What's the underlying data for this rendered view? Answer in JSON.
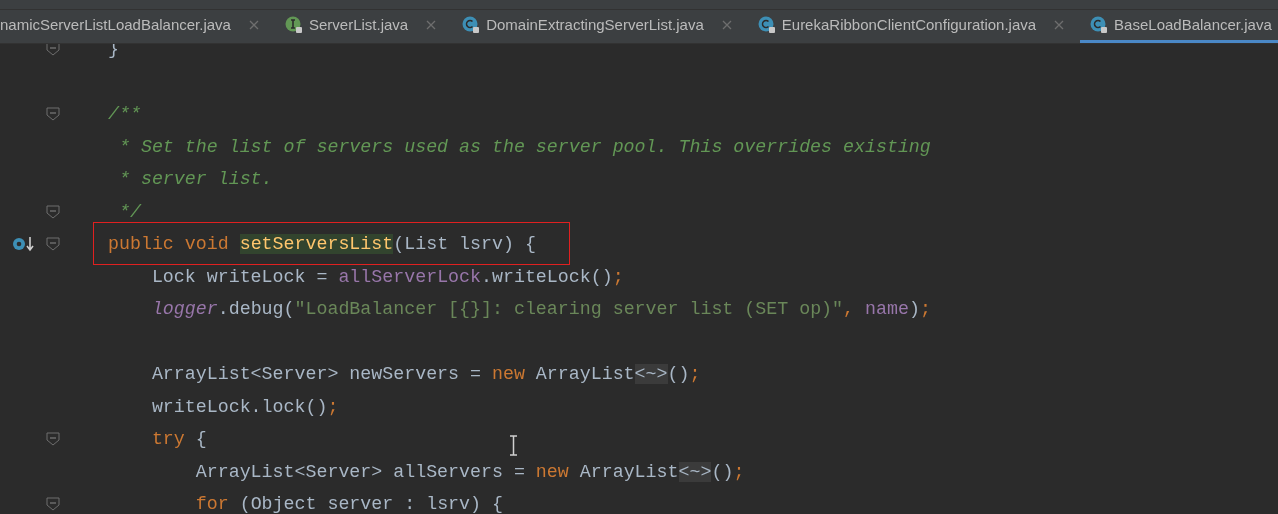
{
  "tabs": [
    {
      "label": "namicServerListLoadBalancer.java",
      "kind": "plain",
      "selected": false,
      "closable": true
    },
    {
      "label": "ServerList.java",
      "kind": "interface",
      "selected": false,
      "closable": true
    },
    {
      "label": "DomainExtractingServerList.java",
      "kind": "class",
      "selected": false,
      "closable": true
    },
    {
      "label": "EurekaRibbonClientConfiguration.java",
      "kind": "class",
      "selected": false,
      "closable": true
    },
    {
      "label": "BaseLoadBalancer.java",
      "kind": "class",
      "selected": true,
      "closable": false
    }
  ],
  "code": {
    "lines": [
      {
        "kind": "code",
        "fold": true,
        "gutter_icon": false,
        "tokens": [
          {
            "kind": "text",
            "text": "}"
          }
        ]
      },
      {
        "kind": "blank"
      },
      {
        "kind": "code",
        "fold": true,
        "gutter_icon": false,
        "tokens": [
          {
            "kind": "comment",
            "text": "/**"
          }
        ]
      },
      {
        "kind": "code",
        "fold": false,
        "gutter_icon": false,
        "tokens": [
          {
            "kind": "comment",
            "text": " * Set the list of servers used as the server pool. This overrides existing"
          }
        ]
      },
      {
        "kind": "code",
        "fold": false,
        "gutter_icon": false,
        "tokens": [
          {
            "kind": "comment",
            "text": " * server list."
          }
        ]
      },
      {
        "kind": "code",
        "fold": true,
        "gutter_icon": false,
        "tokens": [
          {
            "kind": "comment",
            "text": " */"
          }
        ]
      },
      {
        "kind": "code",
        "fold": true,
        "gutter_icon": true,
        "tokens": [
          {
            "kind": "keyword",
            "text": "public void "
          },
          {
            "kind": "method",
            "text": "setServersList"
          },
          {
            "kind": "text",
            "text": "(List lsrv) {"
          }
        ]
      },
      {
        "kind": "code",
        "fold": false,
        "gutter_icon": false,
        "tokens": [
          {
            "kind": "text",
            "text": "    Lock writeLock = "
          },
          {
            "kind": "field",
            "text": "allServerLock"
          },
          {
            "kind": "text",
            "text": ".writeLock()"
          },
          {
            "kind": "keyword",
            "text": ";"
          }
        ]
      },
      {
        "kind": "code",
        "fold": false,
        "gutter_icon": false,
        "tokens": [
          {
            "kind": "static",
            "text": "    logger"
          },
          {
            "kind": "text",
            "text": ".debug("
          },
          {
            "kind": "string",
            "text": "\"LoadBalancer [{}]: clearing server list (SET op)\""
          },
          {
            "kind": "keyword",
            "text": ", "
          },
          {
            "kind": "field",
            "text": "name"
          },
          {
            "kind": "text",
            "text": ")"
          },
          {
            "kind": "keyword",
            "text": ";"
          }
        ]
      },
      {
        "kind": "blank"
      },
      {
        "kind": "code",
        "fold": false,
        "gutter_icon": false,
        "tokens": [
          {
            "kind": "text",
            "text": "    ArrayList<Server> newServers = "
          },
          {
            "kind": "keyword",
            "text": "new "
          },
          {
            "kind": "text",
            "text": "ArrayList"
          },
          {
            "kind": "folded",
            "text": "<~>"
          },
          {
            "kind": "text",
            "text": "()"
          },
          {
            "kind": "keyword",
            "text": ";"
          }
        ]
      },
      {
        "kind": "code",
        "fold": false,
        "gutter_icon": false,
        "tokens": [
          {
            "kind": "text",
            "text": "    writeLock.lock()"
          },
          {
            "kind": "keyword",
            "text": ";"
          }
        ]
      },
      {
        "kind": "code",
        "fold": true,
        "gutter_icon": false,
        "tokens": [
          {
            "kind": "keyword",
            "text": "    try "
          },
          {
            "kind": "text",
            "text": "{"
          }
        ]
      },
      {
        "kind": "code",
        "fold": false,
        "gutter_icon": false,
        "tokens": [
          {
            "kind": "text",
            "text": "        ArrayList<Server> allServers = "
          },
          {
            "kind": "keyword",
            "text": "new "
          },
          {
            "kind": "text",
            "text": "ArrayList"
          },
          {
            "kind": "folded",
            "text": "<~>"
          },
          {
            "kind": "text",
            "text": "()"
          },
          {
            "kind": "keyword",
            "text": ";"
          }
        ]
      },
      {
        "kind": "code",
        "fold": true,
        "gutter_icon": false,
        "tokens": [
          {
            "kind": "keyword",
            "text": "        for "
          },
          {
            "kind": "text",
            "text": "(Object server : lsrv) {"
          }
        ]
      }
    ]
  }
}
